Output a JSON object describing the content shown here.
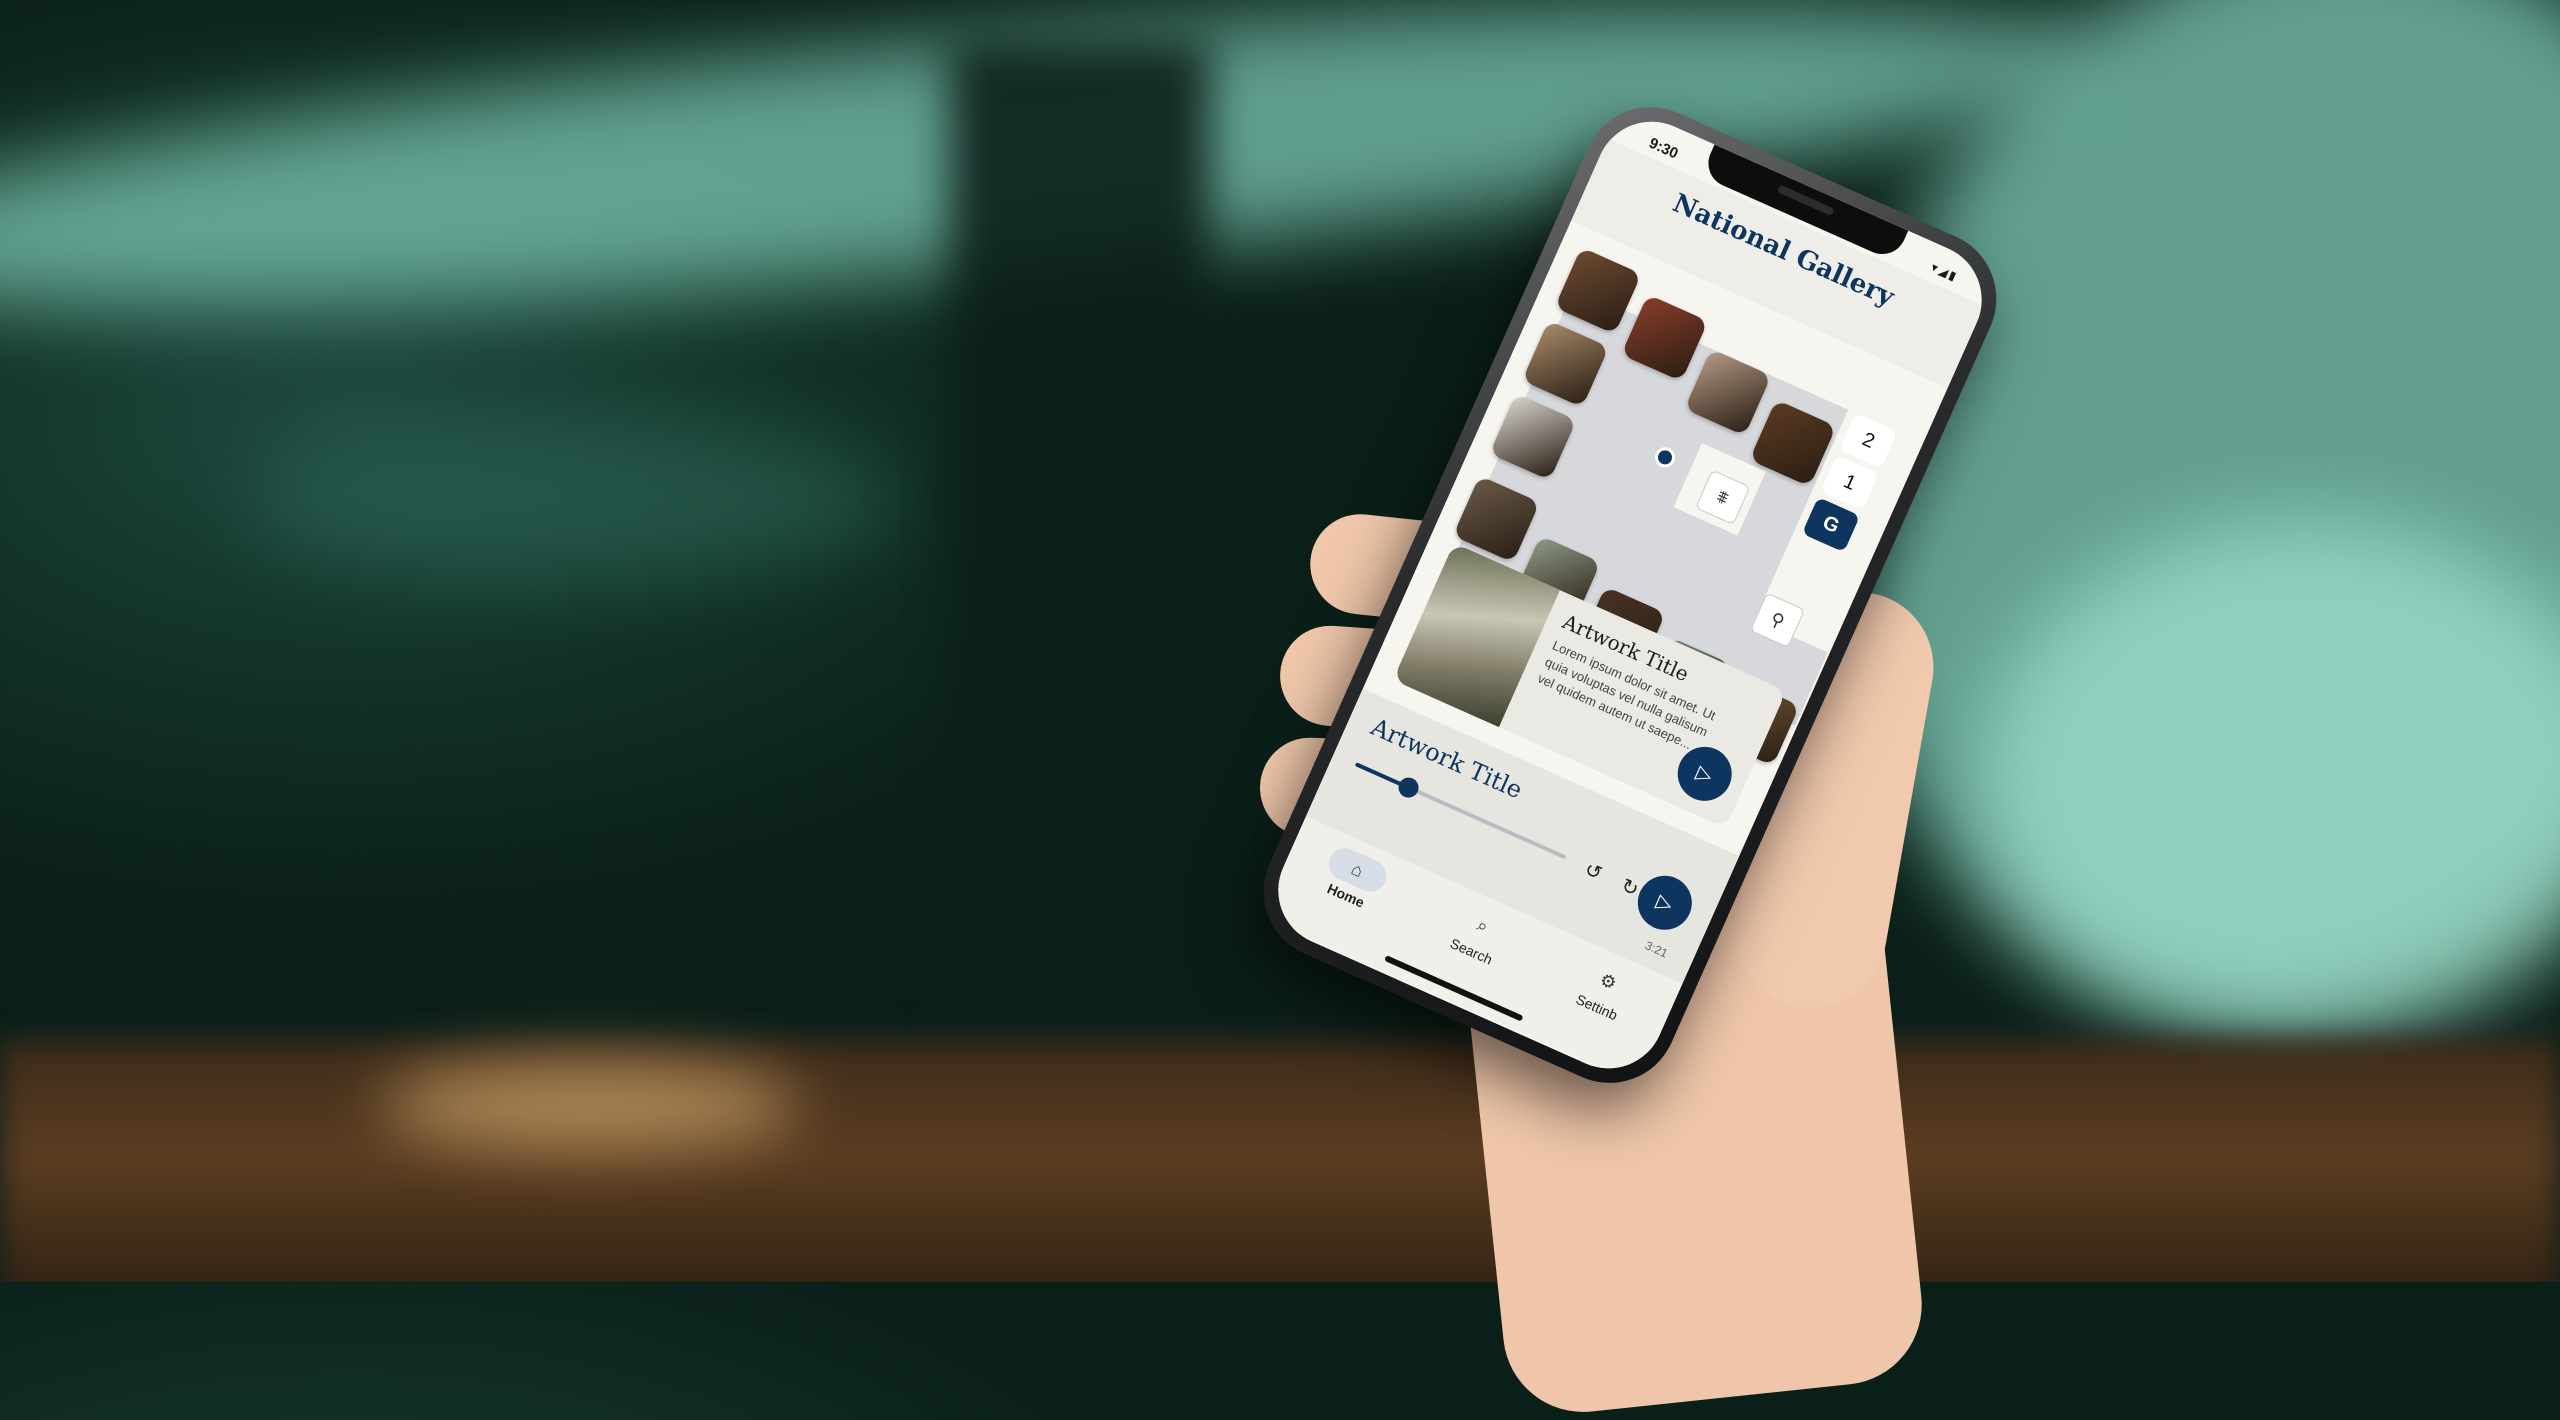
{
  "status_bar": {
    "time": "9:30",
    "icons": "▾◢▮"
  },
  "app": {
    "title": "National Gallery"
  },
  "map": {
    "floors": [
      "2",
      "1",
      "G"
    ],
    "active_floor": "G",
    "icons": [
      "stairs-icon",
      "restroom-icon"
    ],
    "artwork_thumbnails": [
      "#6e4a32",
      "#8a3d2b",
      "#b49a84",
      "#5c3a22",
      "#a88a6a",
      "#d8d5cf",
      "#6a5a48",
      "#8f9a86",
      "#4a3224",
      "#6f8a7a",
      "#7a5a3a"
    ]
  },
  "artwork_card": {
    "title": "Artwork Title",
    "description": "Lorem ipsum dolor sit amet. Ut quia voluptas vel nulla galisum vel quidem autem ut saepe..."
  },
  "player": {
    "title": "Artwork Title",
    "progress": 0.25,
    "remaining": "3:21"
  },
  "nav": {
    "items": [
      {
        "label": "Home",
        "icon": "home-icon"
      },
      {
        "label": "Search",
        "icon": "search-icon"
      },
      {
        "label": "Settinb",
        "icon": "gear-icon"
      }
    ]
  },
  "colors": {
    "accent": "#0e3560",
    "screen_bg": "#f7f5ef"
  }
}
